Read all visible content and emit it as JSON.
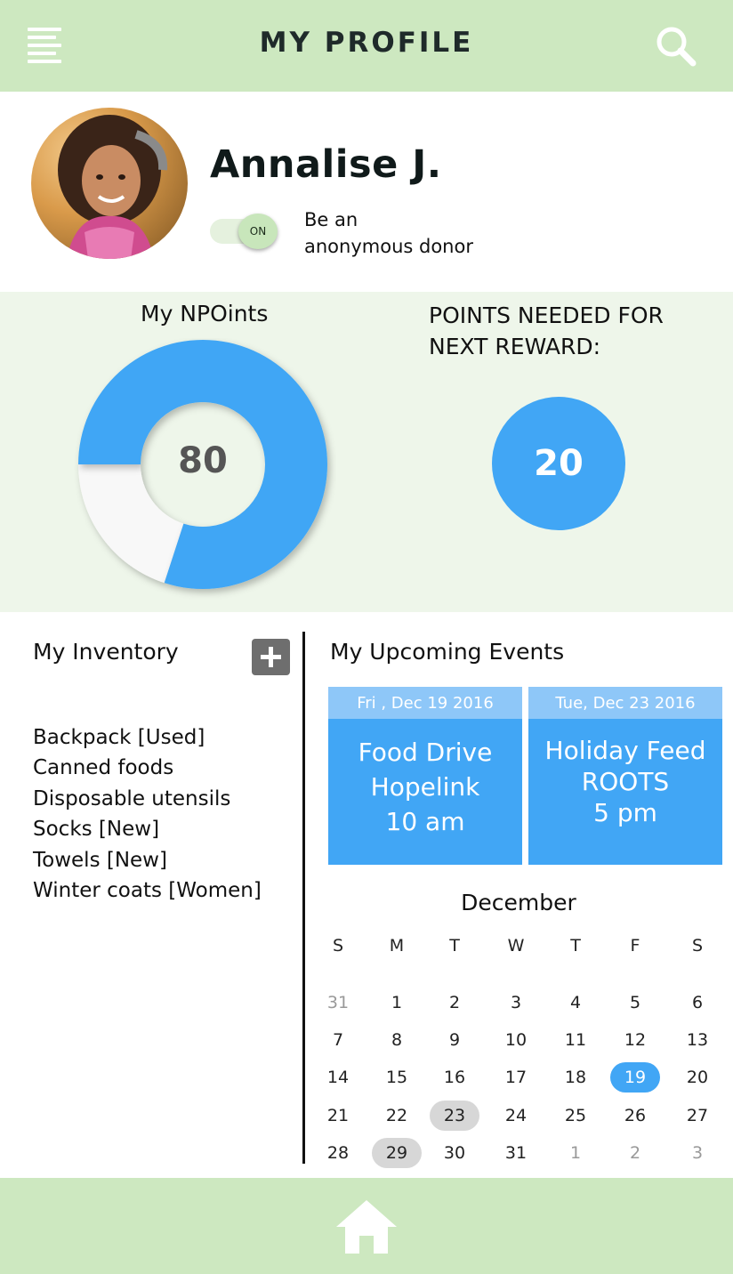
{
  "header": {
    "title": "MY PROFILE",
    "menu_icon": "menu-icon",
    "search_icon": "search-icon"
  },
  "profile": {
    "name": "Annalise J.",
    "avatar_icon": "avatar",
    "toggle_state": "ON",
    "toggle_label_line1": "Be an",
    "toggle_label_line2": "anonymous donor"
  },
  "points": {
    "title": "My NPOints",
    "value": "80",
    "progress_fraction": 0.8,
    "reward_title_line1": "POINTS NEEDED FOR",
    "reward_title_line2": "NEXT REWARD:",
    "reward_value": "20"
  },
  "inventory": {
    "title": "My Inventory",
    "add_icon": "plus-icon",
    "items": [
      "Backpack [Used]",
      "Canned foods",
      "Disposable utensils",
      "Socks [New]",
      "Towels [New]",
      "Winter coats [Women]"
    ]
  },
  "events": {
    "title": "My Upcoming Events",
    "cards": [
      {
        "date": "Fri , Dec 19 2016",
        "line1": "Food Drive",
        "line2": "Hopelink",
        "line3": "10 am"
      },
      {
        "date": "Tue, Dec 23 2016",
        "line1": "Holiday Feed",
        "line2": "ROOTS",
        "line3": "5 pm"
      }
    ]
  },
  "calendar": {
    "month": "December",
    "weekdays": [
      "S",
      "M",
      "T",
      "W",
      "T",
      "F",
      "S"
    ],
    "weeks": [
      [
        "31",
        "1",
        "2",
        "3",
        "4",
        "5",
        "6"
      ],
      [
        "7",
        "8",
        "9",
        "10",
        "11",
        "12",
        "13"
      ],
      [
        "14",
        "15",
        "16",
        "17",
        "18",
        "19",
        "20"
      ],
      [
        "21",
        "22",
        "23",
        "24",
        "25",
        "26",
        "27"
      ],
      [
        "28",
        "29",
        "30",
        "31",
        "1",
        "2",
        "3"
      ]
    ],
    "highlight_today": "19",
    "highlight_events": [
      "23",
      "29"
    ]
  },
  "footer": {
    "home_icon": "home-icon"
  },
  "colors": {
    "header_bg": "#cde8c0",
    "points_bg": "#eef6ea",
    "accent_blue": "#41a6f5",
    "date_strip": "#8ec7f8"
  }
}
